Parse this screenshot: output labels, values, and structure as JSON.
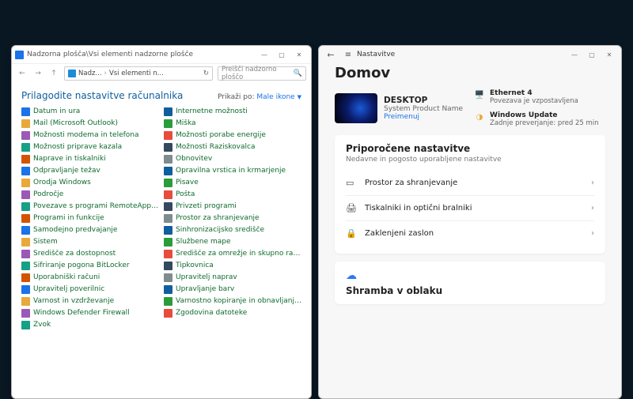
{
  "cp": {
    "caption": "Nadzorna plošča\\Vsi elementi nadzorne plošče",
    "breadcrumbs": [
      "Nadz...",
      "Vsi elementi n..."
    ],
    "search_placeholder": "Preišči nadzorno ploščo",
    "heading": "Prilagodite nastavitve računalnika",
    "viewby_label": "Prikaži po:",
    "viewby_value": "Male ikone",
    "items_left": [
      "Datum in ura",
      "Mail (Microsoft Outlook)",
      "Možnosti modema in telefona",
      "Možnosti priprave kazala",
      "Naprave in tiskalniki",
      "Odpravljanje težav",
      "Orodja Windows",
      "Področje",
      "Povezave s programi RemoteApp in …",
      "Programi in funkcije",
      "Samodejno predvajanje",
      "Sistem",
      "Središče za dostopnost",
      "Šifriranje pogona BitLocker",
      "Uporabniški računi",
      "Upravitelj poverilnic",
      "Varnost in vzdrževanje",
      "Windows Defender Firewall",
      "Zvok"
    ],
    "items_right": [
      "Internetne možnosti",
      "Miška",
      "Možnosti porabe energije",
      "Možnosti Raziskovalca",
      "Obnovitev",
      "Opravilna vrstica in krmarjenje",
      "Pisave",
      "Pošta",
      "Privzeti programi",
      "Prostor za shranjevanje",
      "Sinhronizacijsko središče",
      "Službene mape",
      "Središče za omrežje in skupno rabo",
      "Tipkovnica",
      "Upravitelj naprav",
      "Upravljanje barv",
      "Varnostno kopiranje in obnavljanje…",
      "Zgodovina datoteke"
    ]
  },
  "settings": {
    "app_title": "Nastavitve",
    "home_heading": "Domov",
    "device": {
      "name": "DESKTOP",
      "product": "System Product Name",
      "rename": "Preimenuj"
    },
    "side": {
      "ethernet_title": "Ethernet 4",
      "ethernet_status": "Povezava je vzpostavljena",
      "update_title": "Windows Update",
      "update_status": "Zadnje preverjanje: pred 25 min"
    },
    "recommended": {
      "title": "Priporočene nastavitve",
      "subtitle": "Nedavne in pogosto uporabljene nastavitve",
      "items": [
        "Prostor za shranjevanje",
        "Tiskalniki in optični bralniki",
        "Zaklenjeni zaslon"
      ]
    },
    "cloud_title": "Shramba v oblaku"
  }
}
